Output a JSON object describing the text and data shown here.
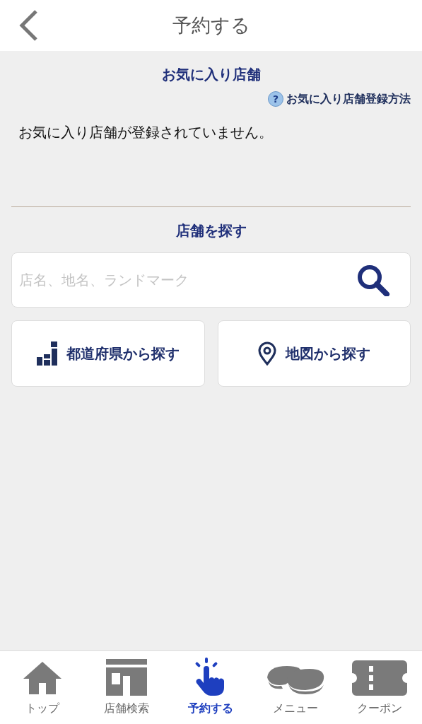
{
  "header": {
    "title": "予約する"
  },
  "favorites": {
    "title": "お気に入り店舗",
    "help_mark": "?",
    "help_link": "お気に入り店舗登録方法",
    "empty_message": "お気に入り店舗が登録されていません。"
  },
  "search": {
    "title": "店舗を探す",
    "placeholder": "店名、地名、ランドマーク"
  },
  "search_buttons": [
    {
      "kind": "prefecture",
      "label": "都道府県から探す"
    },
    {
      "kind": "map",
      "label": "地図から探す"
    }
  ],
  "tabs": [
    {
      "kind": "home",
      "label": "トップ",
      "selected": false
    },
    {
      "kind": "store",
      "label": "店舗検索",
      "selected": false
    },
    {
      "kind": "tap",
      "label": "予約する",
      "selected": true
    },
    {
      "kind": "sushi",
      "label": "メニュー",
      "selected": false
    },
    {
      "kind": "coupon",
      "label": "クーポン",
      "selected": false
    }
  ]
}
